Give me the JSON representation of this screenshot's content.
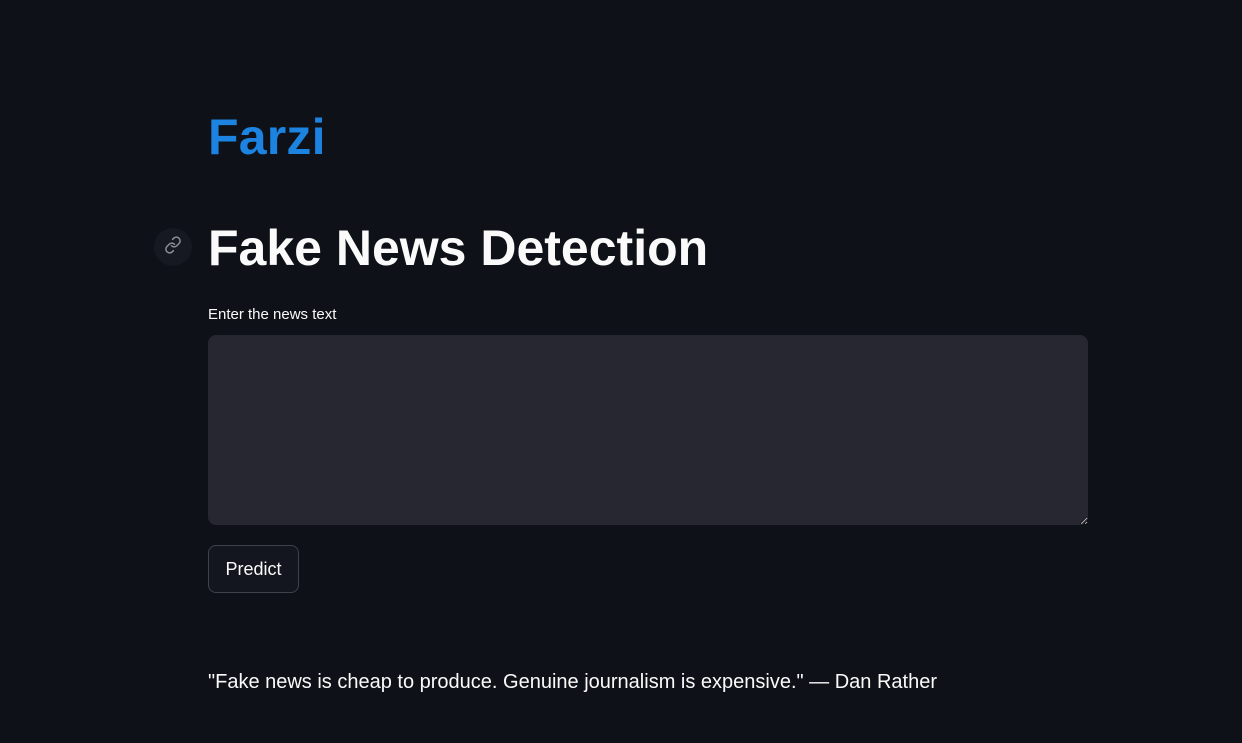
{
  "brand": {
    "title": "Farzi",
    "color": "#1c83e1"
  },
  "header": {
    "title": "Fake News Detection",
    "anchor_icon": "link-icon"
  },
  "form": {
    "label": "Enter the news text",
    "value": "",
    "predict_label": "Predict"
  },
  "footer": {
    "quote": "\"Fake news is cheap to produce. Genuine journalism is expensive.\" — Dan Rather"
  },
  "colors": {
    "background": "#0e1117",
    "input_background": "#262730",
    "text": "#fafafa"
  }
}
